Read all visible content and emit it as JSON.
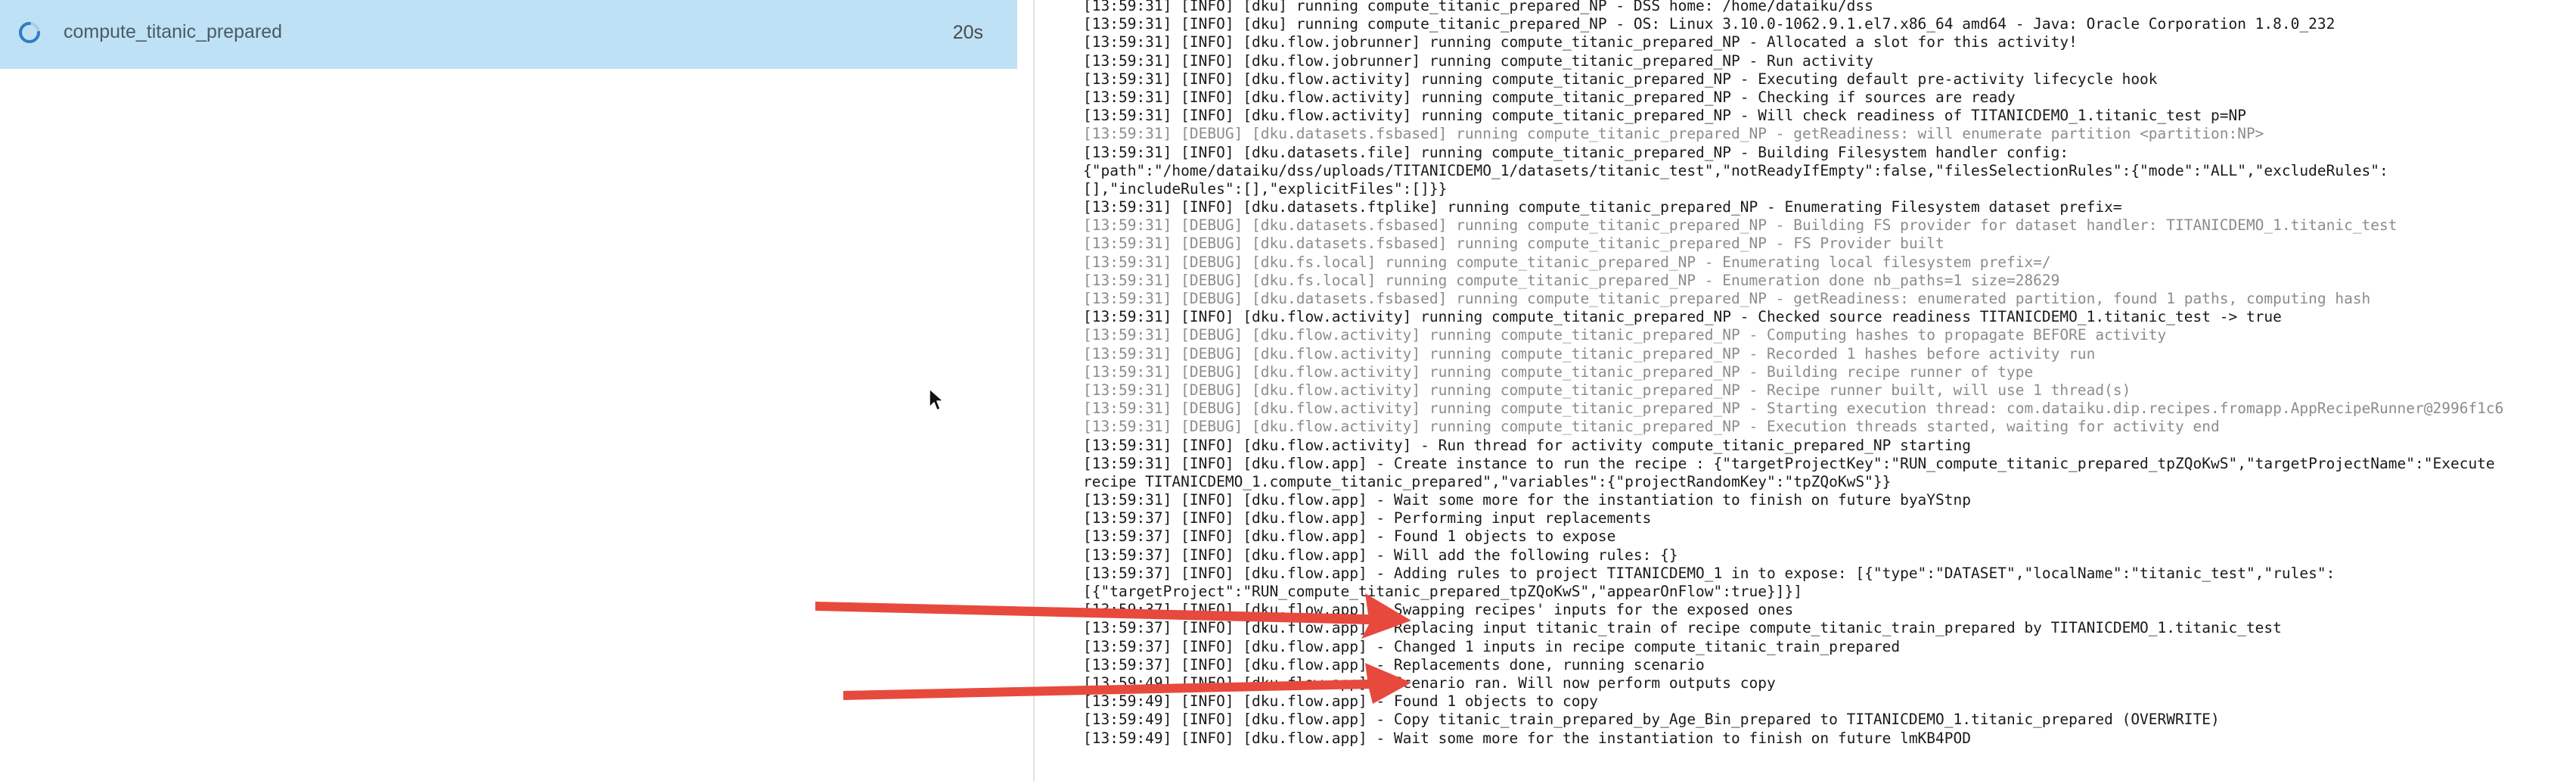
{
  "activity": {
    "name": "compute_titanic_prepared",
    "duration": "20s",
    "status": "running"
  },
  "colors": {
    "selected_row": "#bfe1f5",
    "spinner": "#2d7fc4",
    "arrow": "#e8493d",
    "debug_text": "#8c8c8c",
    "info_text": "#1a1a1a"
  },
  "icons": {
    "spinner": "loading-spinner-icon",
    "cursor": "mouse-pointer-icon",
    "arrow": "red-arrow-annotation"
  },
  "log": [
    {
      "level": "info",
      "text": "[13:59:31] [INFO] [dku] running compute_titanic_prepared_NP - DSS home: /home/dataiku/dss"
    },
    {
      "level": "info",
      "text": "[13:59:31] [INFO] [dku] running compute_titanic_prepared_NP - OS: Linux 3.10.0-1062.9.1.el7.x86_64 amd64 - Java: Oracle Corporation 1.8.0_232"
    },
    {
      "level": "info",
      "text": "[13:59:31] [INFO] [dku.flow.jobrunner] running compute_titanic_prepared_NP - Allocated a slot for this activity!"
    },
    {
      "level": "info",
      "text": "[13:59:31] [INFO] [dku.flow.jobrunner] running compute_titanic_prepared_NP - Run activity"
    },
    {
      "level": "info",
      "text": "[13:59:31] [INFO] [dku.flow.activity] running compute_titanic_prepared_NP - Executing default pre-activity lifecycle hook"
    },
    {
      "level": "info",
      "text": "[13:59:31] [INFO] [dku.flow.activity] running compute_titanic_prepared_NP - Checking if sources are ready"
    },
    {
      "level": "info",
      "text": "[13:59:31] [INFO] [dku.flow.activity] running compute_titanic_prepared_NP - Will check readiness of TITANICDEMO_1.titanic_test p=NP"
    },
    {
      "level": "debug",
      "text": "[13:59:31] [DEBUG] [dku.datasets.fsbased] running compute_titanic_prepared_NP - getReadiness: will enumerate partition <partition:NP>"
    },
    {
      "level": "info",
      "text": "[13:59:31] [INFO] [dku.datasets.file] running compute_titanic_prepared_NP - Building Filesystem handler config:"
    },
    {
      "level": "info",
      "text": "{\"path\":\"/home/dataiku/dss/uploads/TITANICDEMO_1/datasets/titanic_test\",\"notReadyIfEmpty\":false,\"filesSelectionRules\":{\"mode\":\"ALL\",\"excludeRules\":"
    },
    {
      "level": "info",
      "text": "[],\"includeRules\":[],\"explicitFiles\":[]}}"
    },
    {
      "level": "info",
      "text": "[13:59:31] [INFO] [dku.datasets.ftplike] running compute_titanic_prepared_NP - Enumerating Filesystem dataset prefix="
    },
    {
      "level": "debug",
      "text": "[13:59:31] [DEBUG] [dku.datasets.fsbased] running compute_titanic_prepared_NP - Building FS provider for dataset handler: TITANICDEMO_1.titanic_test"
    },
    {
      "level": "debug",
      "text": "[13:59:31] [DEBUG] [dku.datasets.fsbased] running compute_titanic_prepared_NP - FS Provider built"
    },
    {
      "level": "debug",
      "text": "[13:59:31] [DEBUG] [dku.fs.local] running compute_titanic_prepared_NP - Enumerating local filesystem prefix=/"
    },
    {
      "level": "debug",
      "text": "[13:59:31] [DEBUG] [dku.fs.local] running compute_titanic_prepared_NP - Enumeration done nb_paths=1 size=28629"
    },
    {
      "level": "debug",
      "text": "[13:59:31] [DEBUG] [dku.datasets.fsbased] running compute_titanic_prepared_NP - getReadiness: enumerated partition, found 1 paths, computing hash"
    },
    {
      "level": "info",
      "text": "[13:59:31] [INFO] [dku.flow.activity] running compute_titanic_prepared_NP - Checked source readiness TITANICDEMO_1.titanic_test -> true"
    },
    {
      "level": "debug",
      "text": "[13:59:31] [DEBUG] [dku.flow.activity] running compute_titanic_prepared_NP - Computing hashes to propagate BEFORE activity"
    },
    {
      "level": "debug",
      "text": "[13:59:31] [DEBUG] [dku.flow.activity] running compute_titanic_prepared_NP - Recorded 1 hashes before activity run"
    },
    {
      "level": "debug",
      "text": "[13:59:31] [DEBUG] [dku.flow.activity] running compute_titanic_prepared_NP - Building recipe runner of type"
    },
    {
      "level": "debug",
      "text": "[13:59:31] [DEBUG] [dku.flow.activity] running compute_titanic_prepared_NP - Recipe runner built, will use 1 thread(s)"
    },
    {
      "level": "debug",
      "text": "[13:59:31] [DEBUG] [dku.flow.activity] running compute_titanic_prepared_NP - Starting execution thread: com.dataiku.dip.recipes.fromapp.AppRecipeRunner@2996f1c6"
    },
    {
      "level": "debug",
      "text": "[13:59:31] [DEBUG] [dku.flow.activity] running compute_titanic_prepared_NP - Execution threads started, waiting for activity end"
    },
    {
      "level": "info",
      "text": "[13:59:31] [INFO] [dku.flow.activity] - Run thread for activity compute_titanic_prepared_NP starting"
    },
    {
      "level": "info",
      "text": "[13:59:31] [INFO] [dku.flow.app] - Create instance to run the recipe : {\"targetProjectKey\":\"RUN_compute_titanic_prepared_tpZQoKwS\",\"targetProjectName\":\"Execute"
    },
    {
      "level": "info",
      "text": "recipe TITANICDEMO_1.compute_titanic_prepared\",\"variables\":{\"projectRandomKey\":\"tpZQoKwS\"}}"
    },
    {
      "level": "info",
      "text": "[13:59:31] [INFO] [dku.flow.app] - Wait some more for the instantiation to finish on future byaYStnp"
    },
    {
      "level": "info",
      "text": "[13:59:37] [INFO] [dku.flow.app] - Performing input replacements"
    },
    {
      "level": "info",
      "text": "[13:59:37] [INFO] [dku.flow.app] - Found 1 objects to expose"
    },
    {
      "level": "info",
      "text": "[13:59:37] [INFO] [dku.flow.app] - Will add the following rules: {}"
    },
    {
      "level": "info",
      "text": "[13:59:37] [INFO] [dku.flow.app] - Adding rules to project TITANICDEMO_1 in to expose: [{\"type\":\"DATASET\",\"localName\":\"titanic_test\",\"rules\":"
    },
    {
      "level": "info",
      "text": "[{\"targetProject\":\"RUN_compute_titanic_prepared_tpZQoKwS\",\"appearOnFlow\":true}]}]"
    },
    {
      "level": "info",
      "text": "[13:59:37] [INFO] [dku.flow.app] - Swapping recipes' inputs for the exposed ones"
    },
    {
      "level": "info",
      "text": "[13:59:37] [INFO] [dku.flow.app] - Replacing input titanic_train of recipe compute_titanic_train_prepared by TITANICDEMO_1.titanic_test"
    },
    {
      "level": "info",
      "text": "[13:59:37] [INFO] [dku.flow.app] - Changed 1 inputs in recipe compute_titanic_train_prepared"
    },
    {
      "level": "info",
      "text": "[13:59:37] [INFO] [dku.flow.app] - Replacements done, running scenario"
    },
    {
      "level": "info",
      "text": "[13:59:49] [INFO] [dku.flow.app] - Scenario ran. Will now perform outputs copy"
    },
    {
      "level": "info",
      "text": "[13:59:49] [INFO] [dku.flow.app] - Found 1 objects to copy"
    },
    {
      "level": "info",
      "text": "[13:59:49] [INFO] [dku.flow.app] - Copy titanic_train_prepared_by_Age_Bin_prepared to TITANICDEMO_1.titanic_prepared (OVERWRITE)"
    },
    {
      "level": "info",
      "text": "[13:59:49] [INFO] [dku.flow.app] - Wait some more for the instantiation to finish on future lmKB4POD"
    }
  ]
}
